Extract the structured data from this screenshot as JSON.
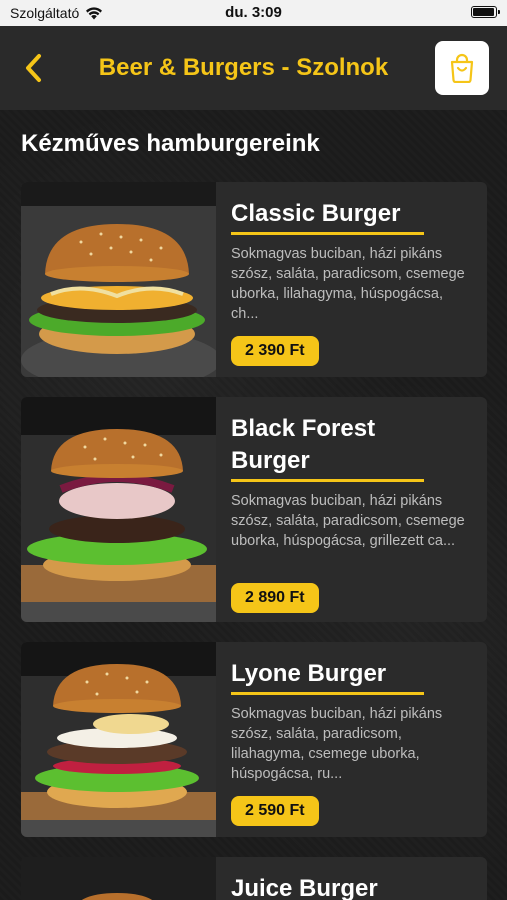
{
  "status_bar": {
    "carrier": "Szolgáltató",
    "time": "du. 3:09"
  },
  "header": {
    "title": "Beer & Burgers - Szolnok",
    "back_icon": "chevron-left-icon",
    "cart_icon": "shopping-bag-icon"
  },
  "section": {
    "title": "Kézműves hamburgereink"
  },
  "colors": {
    "accent": "#f5c518",
    "card": "#2b2b2b",
    "header": "#2a2a2a"
  },
  "products": [
    {
      "name": "Classic Burger",
      "desc": "Sokmagvas buciban, házi pikáns szósz, saláta, paradicsom, csemege uborka, lilahagyma, húspogácsa, ch...",
      "price": "2 390 Ft"
    },
    {
      "name": "Black Forest Burger",
      "desc": "Sokmagvas buciban, házi pikáns szósz, saláta, paradicsom, csemege uborka, húspogácsa, grillezett ca...",
      "price": "2 890 Ft"
    },
    {
      "name": "Lyone Burger",
      "desc": "Sokmagvas buciban, házi pikáns szósz, saláta, paradicsom, lilahagyma, csemege uborka, húspogácsa, ru...",
      "price": "2 590 Ft"
    },
    {
      "name": "Juice Burger"
    }
  ]
}
